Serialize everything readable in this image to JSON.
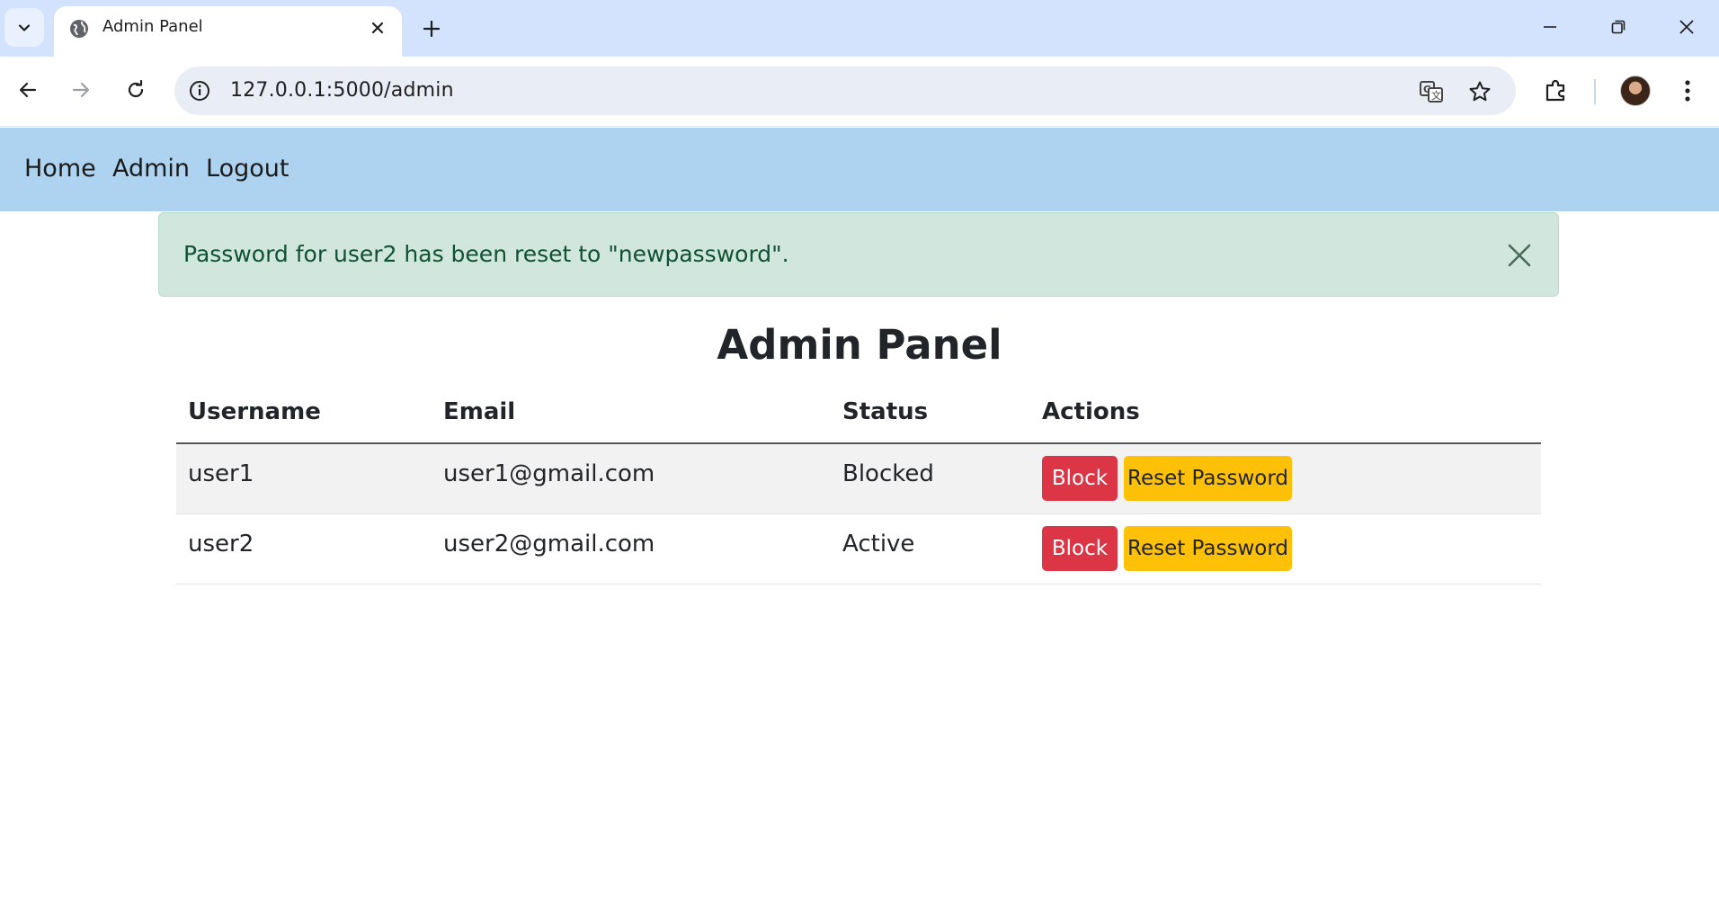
{
  "browser": {
    "tab_title": "Admin Panel",
    "url": "127.0.0.1:5000/admin"
  },
  "nav": {
    "links": [
      "Home",
      "Admin",
      "Logout"
    ]
  },
  "alert": {
    "message": "Password for user2 has been reset to \"newpassword\"."
  },
  "page": {
    "title": "Admin Panel"
  },
  "table": {
    "headers": [
      "Username",
      "Email",
      "Status",
      "Actions"
    ],
    "rows": [
      {
        "username": "user1",
        "email": "user1@gmail.com",
        "status": "Blocked",
        "block_label": "Block",
        "reset_label": "Reset Password"
      },
      {
        "username": "user2",
        "email": "user2@gmail.com",
        "status": "Active",
        "block_label": "Block",
        "reset_label": "Reset Password"
      }
    ]
  },
  "colors": {
    "navbar": "#add3f0",
    "alert_bg": "#d1e7dd",
    "alert_text": "#0f5132",
    "block_button": "#dc3545",
    "reset_button": "#ffc107"
  },
  "icons": [
    "tab-search-icon",
    "globe-icon",
    "close-icon",
    "plus-icon",
    "minimize-icon",
    "restore-icon",
    "back-icon",
    "forward-icon",
    "reload-icon",
    "info-icon",
    "translate-icon",
    "star-icon",
    "extensions-icon",
    "more-icon"
  ]
}
